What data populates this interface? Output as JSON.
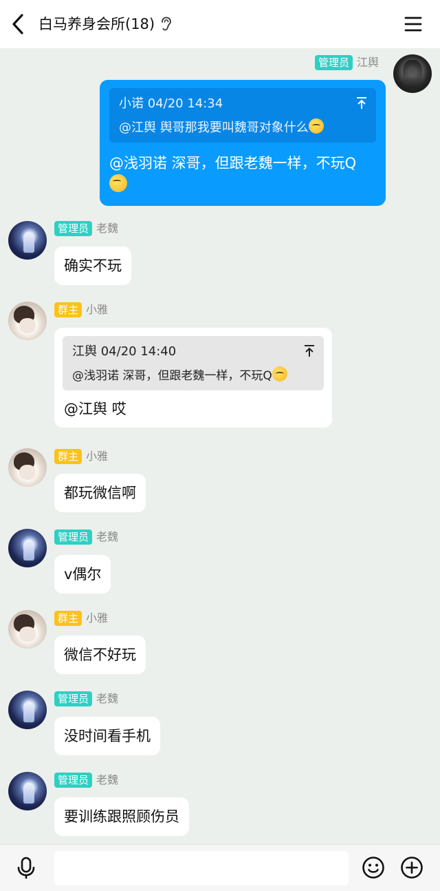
{
  "header": {
    "title": "白马养身会所(18)"
  },
  "messages": [
    {
      "sender": "江舆",
      "badge": "管理员",
      "quote": {
        "header": "小诺 04/20 14:34",
        "text": "@江舆 舆哥那我要叫魏哥对象什么"
      },
      "text": "@浅羽诺 深哥，但跟老魏一样，不玩Q"
    },
    {
      "sender": "老魏",
      "badge": "管理员",
      "text": "确实不玩"
    },
    {
      "sender": "小雅",
      "badge": "群主",
      "quote": {
        "header": "江舆 04/20 14:40",
        "text": "@浅羽诺 深哥，但跟老魏一样，不玩Q"
      },
      "text": "@江舆 哎"
    },
    {
      "sender": "小雅",
      "badge": "群主",
      "text": "都玩微信啊"
    },
    {
      "sender": "老魏",
      "badge": "管理员",
      "text": "v偶尔"
    },
    {
      "sender": "小雅",
      "badge": "群主",
      "text": "微信不好玩"
    },
    {
      "sender": "老魏",
      "badge": "管理员",
      "text": "没时间看手机"
    },
    {
      "sender": "老魏",
      "badge": "管理员",
      "text": "要训练跟照顾伤员"
    }
  ],
  "colors": {
    "background": "#ecf0ed",
    "my_bubble": "#0a9bff",
    "admin_badge": "#2fd0c4",
    "owner_badge": "#fbc21a"
  },
  "icons": {
    "back": "chevron-left-icon",
    "ear": "ear-icon",
    "menu": "menu-icon",
    "mic": "microphone-icon",
    "emoji": "smiley-icon",
    "plus": "plus-circle-icon",
    "quote_jump": "arrow-up-icon"
  }
}
